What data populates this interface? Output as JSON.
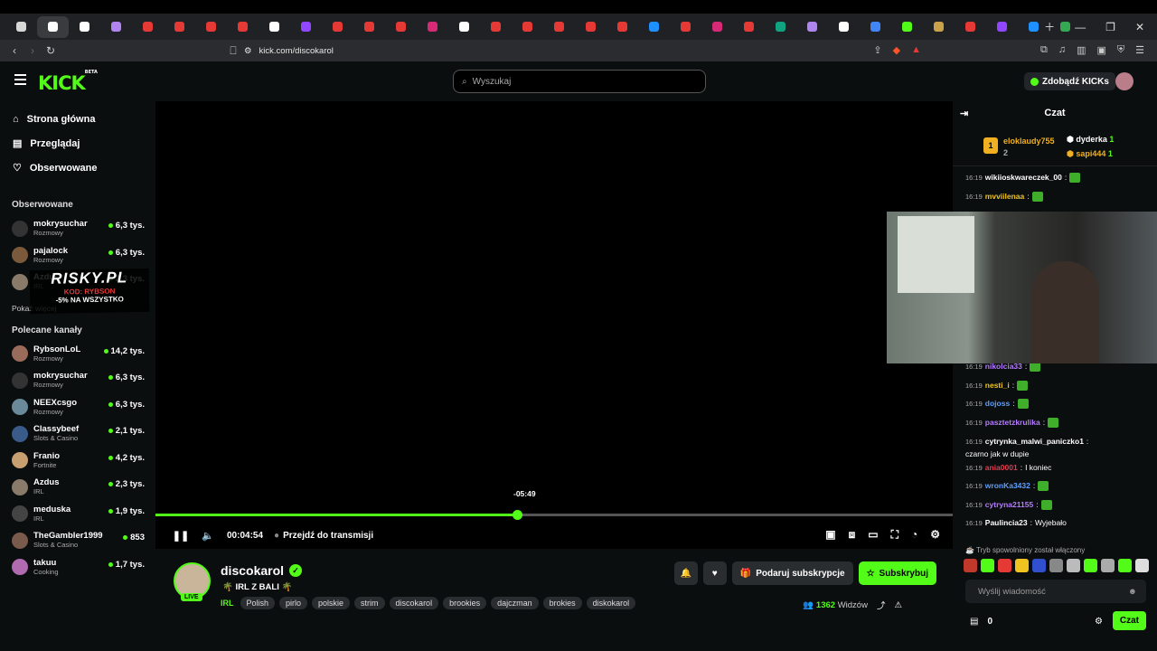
{
  "browser": {
    "url": "kick.com/discokarol",
    "tab_colors": [
      "#d7d7d7",
      "#fff",
      "#fff",
      "#b185f0",
      "#e53935",
      "#e53935",
      "#e53935",
      "#e53935",
      "#fff",
      "#9146ff",
      "#e53935",
      "#e53935",
      "#e53935",
      "#d62976",
      "#fff",
      "#e53935",
      "#e53935",
      "#e53935",
      "#e53935",
      "#e53935",
      "#1e90ff",
      "#e53935",
      "#d62976",
      "#e53935",
      "#10a37f",
      "#b185f0",
      "#fff",
      "#4285f4",
      "#53fc18",
      "#c9a24a",
      "#e53935",
      "#9146ff",
      "#1e90ff",
      "#34a853"
    ]
  },
  "header": {
    "logo": "KICK",
    "logo_badge": "BETA",
    "search_placeholder": "Wyszukaj",
    "get_kicks": "Zdobądź KICKs"
  },
  "sidebar": {
    "nav": [
      {
        "label": "Strona główna",
        "icon": "home-icon"
      },
      {
        "label": "Przeglądaj",
        "icon": "browse-icon"
      },
      {
        "label": "Obserwowane",
        "icon": "heart-icon"
      }
    ],
    "followed_title": "Obserwowane",
    "followed": [
      {
        "name": "mokrysuchar",
        "category": "Rozmowy",
        "viewers": "6,3 tys.",
        "color": "#333"
      },
      {
        "name": "pajalock",
        "category": "Rozmowy",
        "viewers": "6,3 tys.",
        "color": "#7a5a3a"
      },
      {
        "name": "Azdus",
        "category": "IRL",
        "viewers": "2,3 tys.",
        "color": "#8a7a6a"
      }
    ],
    "show_more": "Pokaż więcej",
    "recommended_title": "Polecane kanały",
    "recommended": [
      {
        "name": "RybsonLoL",
        "category": "Rozmowy",
        "viewers": "14,2 tys.",
        "color": "#9a6b5a"
      },
      {
        "name": "mokrysuchar",
        "category": "Rozmowy",
        "viewers": "6,3 tys.",
        "color": "#333"
      },
      {
        "name": "NEEXcsgo",
        "category": "Rozmowy",
        "viewers": "6,3 tys.",
        "color": "#6a8a9a"
      },
      {
        "name": "Classybeef",
        "category": "Slots & Casino",
        "viewers": "2,1 tys.",
        "color": "#3a5a8a"
      },
      {
        "name": "Franio",
        "category": "Fortnite",
        "viewers": "4,2 tys.",
        "color": "#c8a070"
      },
      {
        "name": "Azdus",
        "category": "IRL",
        "viewers": "2,3 tys.",
        "color": "#8a7a6a"
      },
      {
        "name": "meduska",
        "category": "IRL",
        "viewers": "1,9 tys.",
        "color": "#444"
      },
      {
        "name": "TheGambler1999",
        "category": "Slots & Casino",
        "viewers": "853",
        "color": "#7a5a4a"
      },
      {
        "name": "takuu",
        "category": "Cooking",
        "viewers": "1,7 tys.",
        "color": "#b06ab0"
      }
    ],
    "promo": {
      "brand": "RISKY.PL",
      "code": "KOD: RYBSON",
      "offer": "-5% NA WSZYSTKO"
    }
  },
  "player": {
    "scrub_tooltip": "-05:49",
    "progress": 0.453,
    "time": "00:04:54",
    "go_live": "Przejdź do transmisji"
  },
  "stream": {
    "channel": "discokarol",
    "live_badge": "LIVE",
    "title": "🌴 IRL Z BALI 🌴",
    "category": "IRL",
    "tags": [
      "Polish",
      "pirlo",
      "polskie",
      "strim",
      "discokarol",
      "brookies",
      "dajczman",
      "brokies",
      "diskokarol"
    ],
    "gift_sub": "Podaruj subskrypcje",
    "subscribe": "Subskrybuj",
    "viewers": "1362",
    "viewers_label": "Widzów"
  },
  "chat": {
    "title": "Czat",
    "leaderboard": {
      "first": {
        "rank": "1",
        "name": "eloklaudy755",
        "count": "2"
      },
      "others": [
        {
          "name": "dyderka",
          "count": "1"
        },
        {
          "name": "sapi444",
          "count": "1"
        }
      ]
    },
    "messages": [
      {
        "time": "16:19",
        "user": "wikiioskwareczek_00",
        "text": "",
        "color": "#fff"
      },
      {
        "time": "16:19",
        "user": "mvviilenaa",
        "text": "",
        "color": "#f0c420"
      },
      {
        "time": "16:19",
        "user": "nikolcia33",
        "text": "",
        "color": "#b57cff"
      },
      {
        "time": "16:19",
        "user": "nesti_i",
        "text": "",
        "color": "#f0c420"
      },
      {
        "time": "16:19",
        "user": "dojoss",
        "text": "",
        "color": "#5c9dff"
      },
      {
        "time": "16:19",
        "user": "pasztetzkrulika",
        "text": "",
        "color": "#b57cff"
      },
      {
        "time": "16:19",
        "user": "cytrynka_malwi_paniczko1",
        "text": "czarno jak w dupie",
        "color": "#fff"
      },
      {
        "time": "16:19",
        "user": "ania0001",
        "text": "I koniec",
        "color": "#e53950"
      },
      {
        "time": "16:19",
        "user": "wronKa3432",
        "text": "",
        "color": "#5c9dff"
      },
      {
        "time": "16:19",
        "user": "cytryna21155",
        "text": "",
        "color": "#b57cff"
      },
      {
        "time": "16:19",
        "user": "Paulincia23",
        "text": "Wyjebało",
        "color": "#fff"
      }
    ],
    "slow_mode": "Tryb spowolniony został włączony",
    "input_placeholder": "Wyślij wiadomość",
    "kicks": "0",
    "send": "Czat"
  }
}
